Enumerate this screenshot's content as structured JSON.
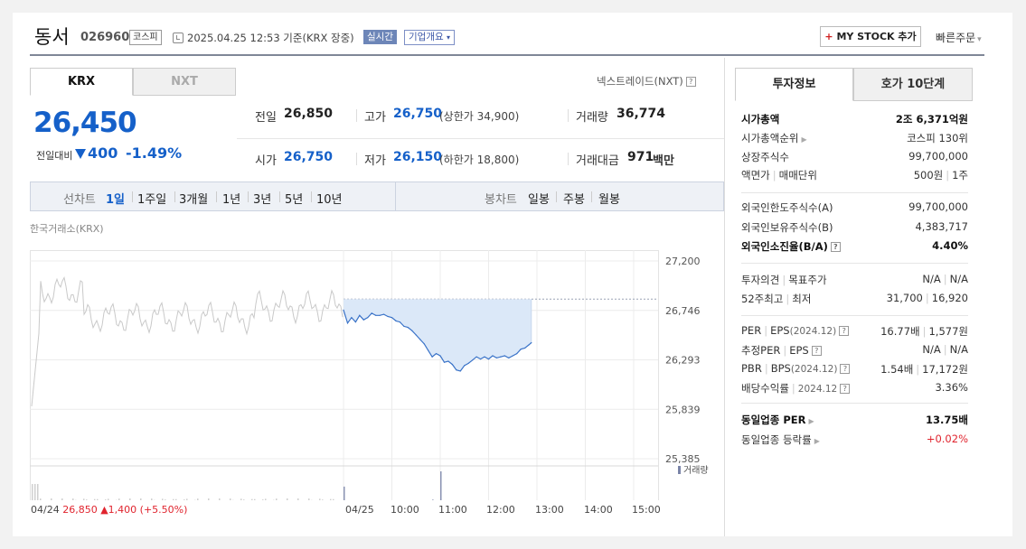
{
  "header": {
    "company_name": "동서",
    "company_code": "026960",
    "market_badge": "코스피",
    "datetime": "2025.04.25 12:53 기준(KRX 장중)",
    "realtime_badge": "실시간",
    "overview_button": "기업개요",
    "mystock_plus": "+",
    "mystock_label": "MY STOCK 추가",
    "quick_order": "빠른주문"
  },
  "market_tabs": {
    "krx": "KRX",
    "nxt": "NXT",
    "nxt_link": "넥스트레이드(NXT)"
  },
  "price": {
    "current": "26,450",
    "change_label": "전일대비",
    "change_value": "400",
    "change_rate": "-1.49%",
    "direction": "down",
    "color": "#1560c9"
  },
  "stats": {
    "prev_close": {
      "label": "전일",
      "value": "26,850"
    },
    "high": {
      "label": "고가",
      "value": "26,750",
      "sub": "(상한가 34,900)"
    },
    "volume": {
      "label": "거래량",
      "value": "36,774"
    },
    "open": {
      "label": "시가",
      "value": "26,750"
    },
    "low": {
      "label": "저가",
      "value": "26,150",
      "sub": "(하한가 18,800)"
    },
    "trade_amount": {
      "label": "거래대금",
      "value": "971",
      "unit": "백만"
    }
  },
  "period_bar": {
    "line_label": "선차트",
    "line_options": [
      "1일",
      "1주일",
      "3개월",
      "1년",
      "3년",
      "5년",
      "10년"
    ],
    "line_selected": "1일",
    "candle_label": "봉차트",
    "candle_options": [
      "일봉",
      "주봉",
      "월봉"
    ]
  },
  "chart_data": {
    "type": "line",
    "exchange_label": "한국거래소(KRX)",
    "y_ticks": [
      "27,200",
      "26,746",
      "26,293",
      "25,839",
      "25,385"
    ],
    "ylim": [
      25385,
      27200
    ],
    "prev_close": 26850,
    "volume_legend": "거래량",
    "prev_day": {
      "date": "04/24",
      "close": "26,850",
      "change_arrow": "▲",
      "change": "1,400",
      "rate": "(+5.50%)",
      "color": "#e0242e"
    },
    "x_ticks": [
      "04/25",
      "10:00",
      "11:00",
      "12:00",
      "13:00",
      "14:00",
      "15:00"
    ],
    "series": [
      {
        "time": [
          "09:00",
          "09:05",
          "09:10",
          "09:15",
          "09:20",
          "09:25",
          "09:30",
          "09:35",
          "09:40",
          "09:45",
          "09:50",
          "09:55",
          "10:00",
          "10:05",
          "10:10",
          "10:15",
          "10:20",
          "10:25",
          "10:30",
          "10:35",
          "10:40",
          "10:45",
          "10:50",
          "10:55",
          "11:00",
          "11:05",
          "11:10",
          "11:15",
          "11:20",
          "11:25",
          "11:30",
          "11:35",
          "11:40",
          "11:45",
          "11:50",
          "11:55",
          "12:00",
          "12:05",
          "12:10",
          "12:15",
          "12:20",
          "12:25",
          "12:30",
          "12:35",
          "12:40",
          "12:45",
          "12:50",
          "12:53"
        ],
        "values": [
          26750,
          26630,
          26680,
          26640,
          26700,
          26660,
          26680,
          26720,
          26700,
          26700,
          26710,
          26690,
          26680,
          26650,
          26640,
          26600,
          26590,
          26560,
          26520,
          26480,
          26440,
          26380,
          26320,
          26350,
          26330,
          26270,
          26280,
          26250,
          26200,
          26190,
          26240,
          26260,
          26290,
          26320,
          26300,
          26320,
          26300,
          26330,
          26310,
          26320,
          26330,
          26310,
          26330,
          26350,
          26390,
          26400,
          26430,
          26450
        ]
      }
    ],
    "volume": {
      "time": [
        "09:00",
        "09:10",
        "09:20",
        "09:30",
        "09:40",
        "09:50",
        "10:00",
        "10:10",
        "10:20",
        "10:30",
        "10:40",
        "10:50",
        "11:00",
        "11:10",
        "11:20",
        "11:30",
        "11:40",
        "11:50",
        "12:00",
        "12:10",
        "12:20",
        "12:30",
        "12:40",
        "12:50"
      ],
      "values": [
        3200,
        1400,
        1100,
        900,
        700,
        800,
        600,
        500,
        700,
        900,
        1300,
        1500,
        5200,
        1200,
        800,
        600,
        500,
        700,
        600,
        500,
        800,
        600,
        500,
        700
      ]
    }
  },
  "invest_tabs": {
    "invest_info": "투자정보",
    "hoga": "호가 10단계"
  },
  "invest": {
    "market_cap": {
      "label": "시가총액",
      "value": "2조 6,371억원"
    },
    "market_cap_rank": {
      "label": "시가총액순위",
      "value": "코스피 130위"
    },
    "shares_listed": {
      "label": "상장주식수",
      "value": "99,700,000"
    },
    "par_value": {
      "label": "액면가",
      "label2": "매매단위",
      "value": "500원",
      "value2": "1주"
    },
    "foreign_limit": {
      "label": "외국인한도주식수(A)",
      "value": "99,700,000"
    },
    "foreign_holding": {
      "label": "외국인보유주식수(B)",
      "value": "4,383,717"
    },
    "foreign_rate": {
      "label": "외국인소진율(B/A)",
      "value": "4.40%"
    },
    "opinion": {
      "label": "투자의견",
      "label2": "목표주가",
      "value": "N/A",
      "value2": "N/A"
    },
    "week52": {
      "label": "52주최고",
      "label2": "최저",
      "value": "31,700",
      "value2": "16,920"
    },
    "per_eps": {
      "label": "PER",
      "label2": "EPS",
      "period": "(2024.12)",
      "value": "16.77배",
      "value2": "1,577원"
    },
    "est_per_eps": {
      "label": "추정PER",
      "label2": "EPS",
      "value": "N/A",
      "value2": "N/A"
    },
    "pbr_bps": {
      "label": "PBR",
      "label2": "BPS",
      "period": "(2024.12)",
      "value": "1.54배",
      "value2": "17,172원"
    },
    "dividend": {
      "label": "배당수익률",
      "period": "2024.12",
      "value": "3.36%"
    },
    "sector_per": {
      "label": "동일업종 PER",
      "value": "13.75배"
    },
    "sector_change": {
      "label": "동일업종 등락률",
      "value": "+0.02%"
    }
  },
  "colors": {
    "up": "#e0242e",
    "down": "#1560c9",
    "chart_line": "#3a73c8",
    "chart_fill": "#dbe8f8"
  }
}
